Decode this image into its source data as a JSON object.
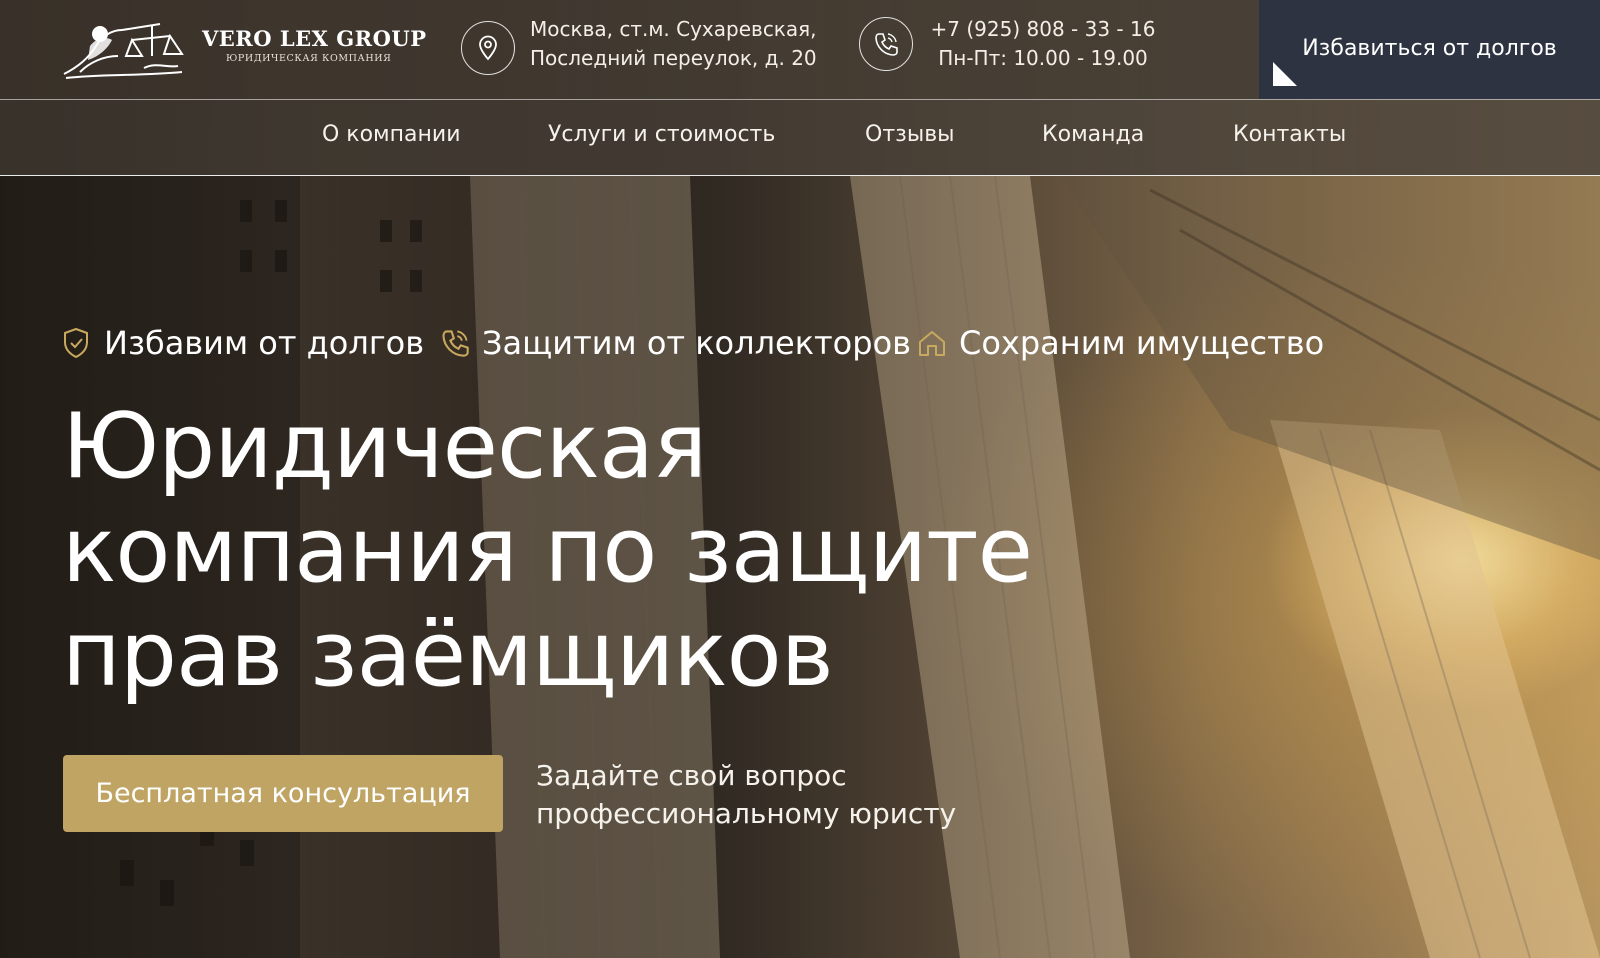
{
  "header": {
    "logo": {
      "title": "VERO LEX GROUP",
      "subtitle": "ЮРИДИЧЕСКАЯ КОМПАНИЯ",
      "icon": "themis-scales-icon"
    },
    "address": {
      "icon": "map-pin-icon",
      "line1": "Москва, ст.м. Сухаревская,",
      "line2": "Последний переулок, д. 20"
    },
    "contact": {
      "icon": "phone-icon",
      "phone": "+7 (925) 808 - 33 - 16",
      "hours": "Пн-Пт: 10.00 - 19.00"
    },
    "cta_label": "Избавиться от долгов"
  },
  "nav": {
    "items": [
      {
        "label": "О компании"
      },
      {
        "label": "Услуги и стоимость"
      },
      {
        "label": "Отзывы"
      },
      {
        "label": "Команда"
      },
      {
        "label": "Контакты"
      }
    ]
  },
  "hero": {
    "features": [
      {
        "icon": "shield-check-icon",
        "label": "Избавим от долгов"
      },
      {
        "icon": "phone-call-icon",
        "label": "Защитим от коллекторов"
      },
      {
        "icon": "home-icon",
        "label": "Сохраним имущество"
      }
    ],
    "headline": {
      "line1": "Юридическая",
      "line2": "компания по защите",
      "line3": "прав заёмщиков"
    },
    "button_label": "Бесплатная консультация",
    "ask_line1": "Задайте свой вопрос",
    "ask_line2": "профессиональному юристу"
  },
  "colors": {
    "accent_gold": "#bfa463",
    "cta_dark": "#2d3340",
    "icon_gold": "#c9a95e"
  }
}
